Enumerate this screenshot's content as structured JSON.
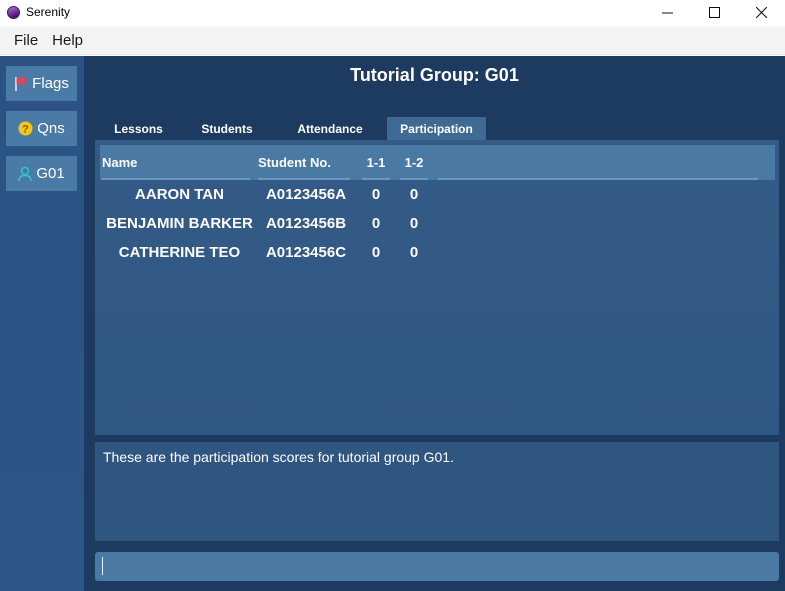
{
  "window": {
    "title": "Serenity",
    "controls": [
      "minimize",
      "maximize",
      "close"
    ]
  },
  "menu": {
    "file": "File",
    "help": "Help"
  },
  "sidebar": {
    "items": [
      {
        "label": "Flags",
        "icon": "flag-icon"
      },
      {
        "label": "Qns",
        "icon": "question-icon"
      },
      {
        "label": "G01",
        "icon": "user-icon"
      }
    ]
  },
  "main": {
    "title": "Tutorial Group: G01",
    "tabs": [
      {
        "label": "Lessons",
        "selected": false
      },
      {
        "label": "Students",
        "selected": false
      },
      {
        "label": "Attendance",
        "selected": false
      },
      {
        "label": "Participation",
        "selected": true
      }
    ],
    "table": {
      "columns": [
        "Name",
        "Student No.",
        "1-1",
        "1-2"
      ],
      "rows": [
        {
          "name": "AARON TAN",
          "student_no": "A0123456A",
          "s1_1": "0",
          "s1_2": "0"
        },
        {
          "name": "BENJAMIN BARKER",
          "student_no": "A0123456B",
          "s1_1": "0",
          "s1_2": "0"
        },
        {
          "name": "CATHERINE TEO",
          "student_no": "A0123456C",
          "s1_1": "0",
          "s1_2": "0"
        }
      ]
    },
    "result_text": "These are the participation scores for tutorial group G01.",
    "command_input": {
      "value": ""
    }
  },
  "colors": {
    "content_bg": "#1d3a60",
    "sidebar_bg": "#2a5383",
    "button_bg": "#4a7ba6",
    "header_bg": "#4a7aa4",
    "flag_red": "#e0455a",
    "question_yellow": "#f5c518",
    "user_teal": "#2ec4d6"
  }
}
